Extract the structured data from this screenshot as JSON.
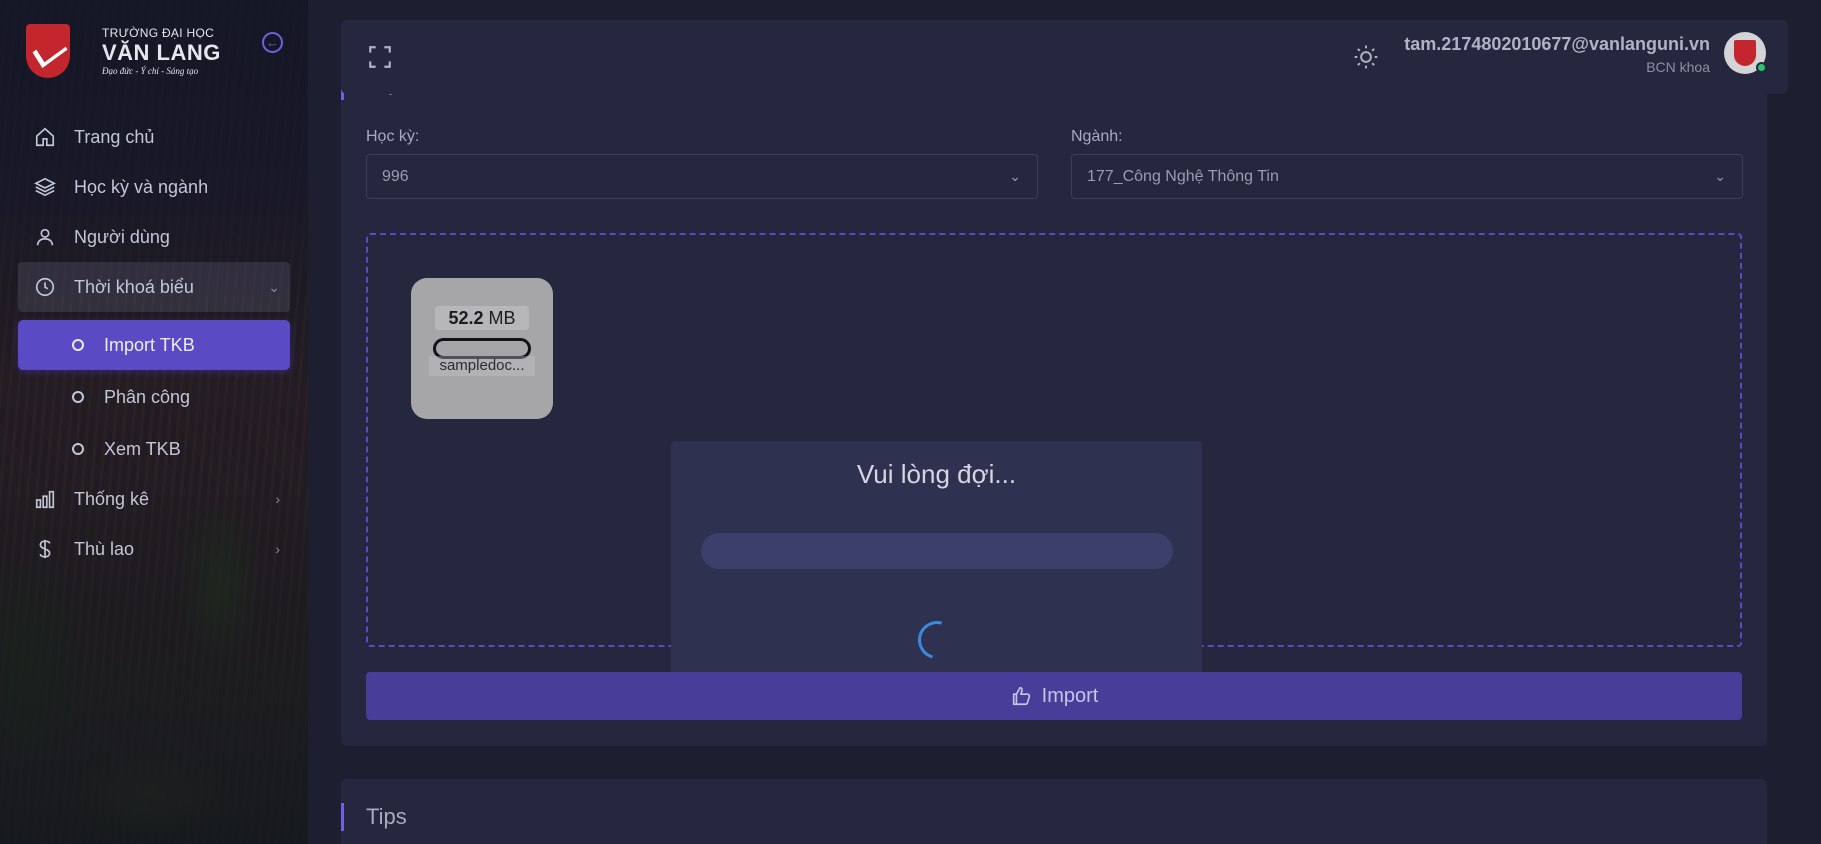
{
  "brand": {
    "line1": "TRƯỜNG ĐẠI HỌC",
    "line2": "VĂN LANG",
    "line3": "Đạo đức - Ý chí - Sáng tạo",
    "logo_color": "#c4262d"
  },
  "sidebar": {
    "items": [
      {
        "label": "Trang chủ",
        "icon": "home-icon"
      },
      {
        "label": "Học kỳ và ngành",
        "icon": "layers-icon"
      },
      {
        "label": "Người dùng",
        "icon": "user-icon"
      },
      {
        "label": "Thời khoá biểu",
        "icon": "clock-icon",
        "expanded": true
      }
    ],
    "sub_items": [
      {
        "label": "Import TKB",
        "active": true
      },
      {
        "label": "Phân công"
      },
      {
        "label": "Xem TKB"
      }
    ],
    "items_after": [
      {
        "label": "Thống kê",
        "icon": "bar-chart-icon"
      },
      {
        "label": "Thù lao",
        "icon": "dollar-icon"
      }
    ]
  },
  "header": {
    "email": "tam.2174802010677@vanlanguni.vn",
    "role": "BCN khoa",
    "status_color": "#28c76f"
  },
  "main": {
    "section_title": "Import TKB",
    "semester_label": "Học kỳ:",
    "semester_value": "996",
    "major_label": "Ngành:",
    "major_value": "177_Công Nghệ Thông Tin",
    "file": {
      "size_value": "52.2",
      "size_unit": "MB",
      "name": "sampledoc..."
    },
    "loading": {
      "title": "Vui lòng đợi..."
    },
    "import_label": "Import",
    "accent_color": "#5a4bc4"
  },
  "tips": {
    "title": "Tips"
  }
}
